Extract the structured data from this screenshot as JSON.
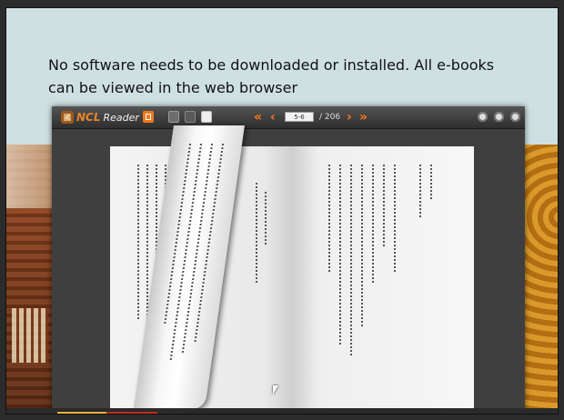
{
  "slide": {
    "caption": "No software needs to be downloaded or installed. All e-books can be viewed in the web browser"
  },
  "reader": {
    "logo_seal": "國",
    "logo_ncl": "NCL",
    "logo_reader": "Reader",
    "current_page": "5-6",
    "total_pages": "/ 206",
    "nav_first": "«",
    "nav_prev": "‹",
    "nav_next": "›",
    "nav_last": "»"
  },
  "colors": {
    "accent_orange": "#ff7a18",
    "header_band": "#cfe0e3",
    "gold": "#e6b43a",
    "red": "#c02c20"
  },
  "icons": [
    "logo-seal-icon",
    "toc-icon",
    "thumbnail-icon",
    "two-page-icon",
    "single-page-icon",
    "zoom-in-icon",
    "zoom-out-icon",
    "fullscreen-icon",
    "cursor-icon"
  ]
}
